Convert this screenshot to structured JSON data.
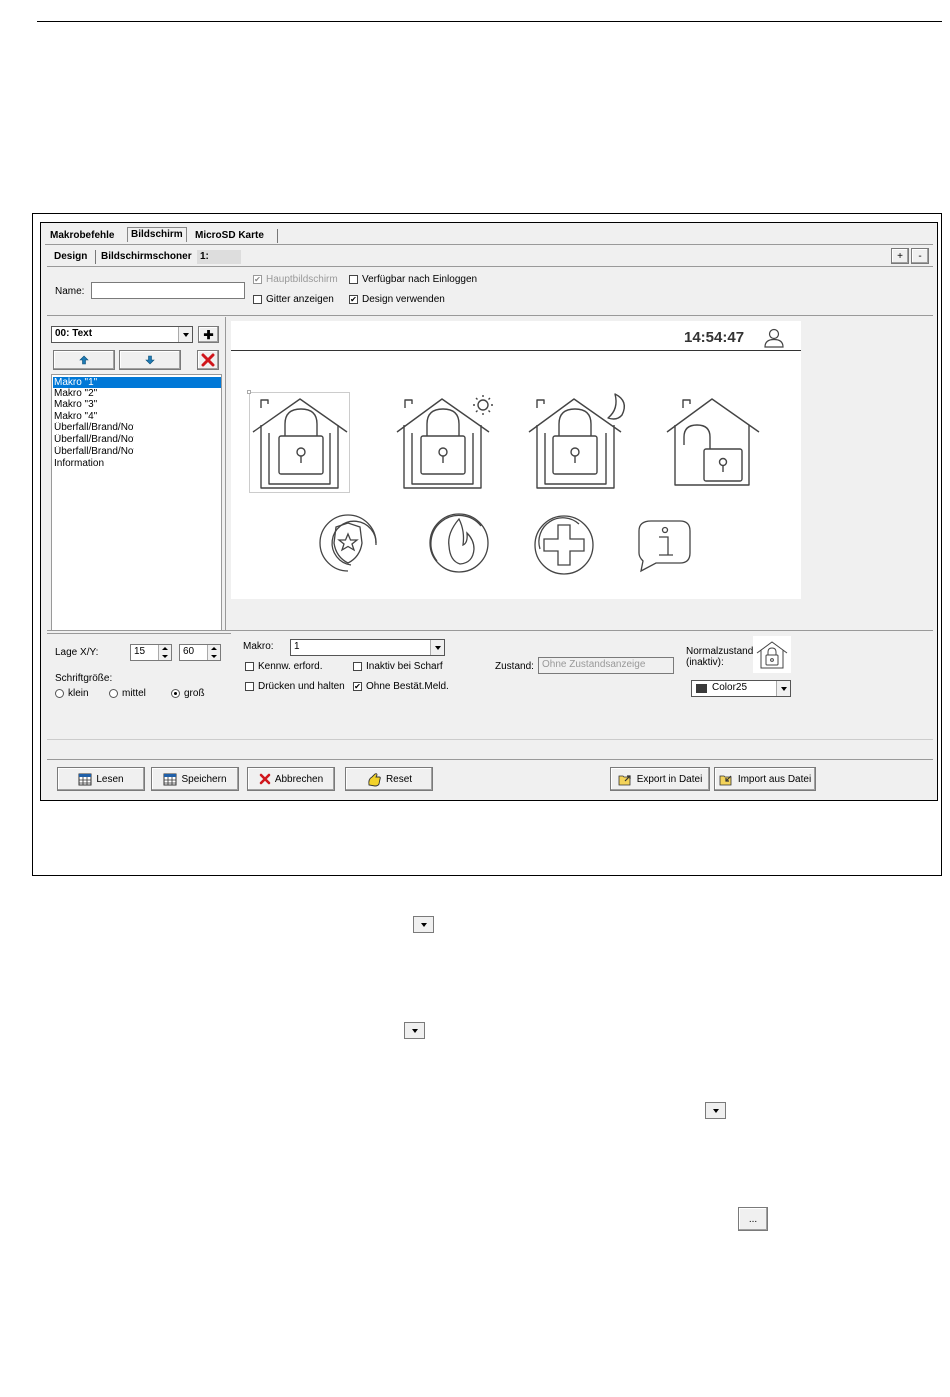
{
  "tabs_top": [
    "Makrobefehle",
    "Bildschirm",
    "MicroSD Karte"
  ],
  "tabs_sub": [
    "Design",
    "Bildschirmschoner",
    "1:"
  ],
  "plus_label": "+",
  "minus_label": "-",
  "name_label": "Name:",
  "name_value": "",
  "checks_top": [
    {
      "label": "Hauptbildschirm",
      "checked": true,
      "disabled": true
    },
    {
      "label": "Verfügbar nach Einloggen",
      "checked": false
    },
    {
      "label": "Gitter anzeigen",
      "checked": false
    },
    {
      "label": "Design verwenden",
      "checked": true
    }
  ],
  "element_select": "00: Text",
  "list_items": [
    "Makro \"1\"",
    "Makro \"2\"",
    "Makro \"3\"",
    "Makro \"4\"",
    "Überfall/Brand/Notruf",
    "Überfall/Brand/Notruf",
    "Überfall/Brand/Notruf",
    "Information"
  ],
  "clock": "14:54:47",
  "lage_label": "Lage X/Y:",
  "x_value": "15",
  "y_value": "60",
  "schrift_label": "Schriftgröße:",
  "radios": [
    {
      "label": "klein",
      "checked": false
    },
    {
      "label": "mittel",
      "checked": false
    },
    {
      "label": "groß",
      "checked": true
    }
  ],
  "makro_label": "Makro:",
  "makro_value": "1",
  "checks_bottom": [
    {
      "label": "Kennw. erford.",
      "checked": false
    },
    {
      "label": "Inaktiv bei Scharf",
      "checked": false
    },
    {
      "label": "Drücken und halten",
      "checked": false
    },
    {
      "label": "Ohne Bestät.Meld.",
      "checked": true
    }
  ],
  "zustand_label": "Zustand:",
  "zustand_value": "Ohne Zustandsanzeige",
  "normal_label_1": "Normalzustand",
  "normal_label_2": "(inaktiv):",
  "color_value": "Color25",
  "color_swatch": "#3a3a3a",
  "buttons_bottom": [
    "Lesen",
    "Speichern",
    "Abbrechen",
    "Reset",
    "Export in Datei",
    "Import aus Datei"
  ],
  "ellipsis_label": "...",
  "accent": "#0078d7",
  "icon_color": "#444444"
}
